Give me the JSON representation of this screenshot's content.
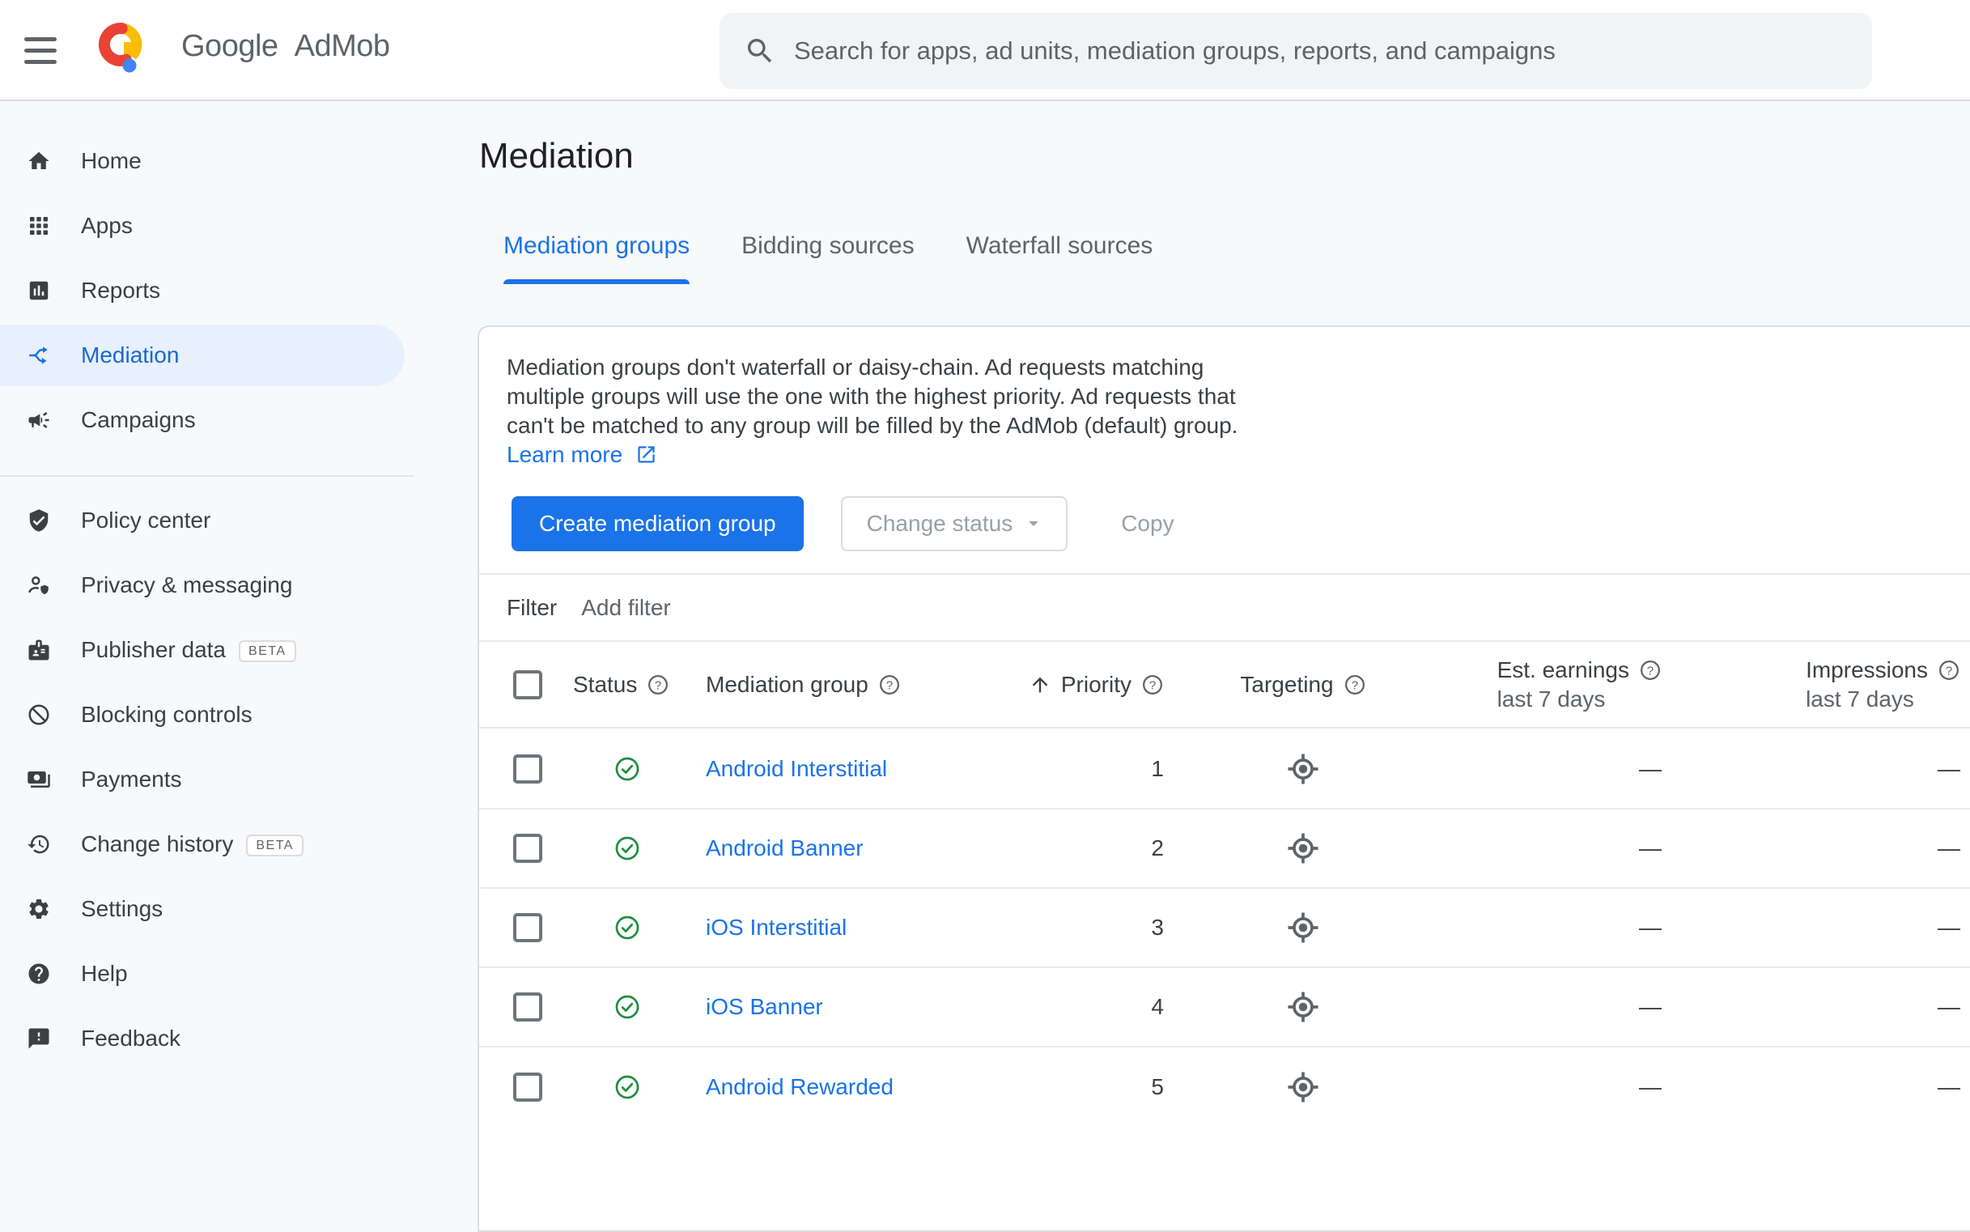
{
  "header": {
    "logo_brand": "Google",
    "logo_product": "AdMob",
    "search": {
      "placeholder": "Search for apps, ad units, mediation groups, reports, and campaigns"
    }
  },
  "sidebar": {
    "beta_label": "BETA",
    "primary": [
      {
        "label": "Home"
      },
      {
        "label": "Apps"
      },
      {
        "label": "Reports"
      },
      {
        "label": "Mediation",
        "active": true
      },
      {
        "label": "Campaigns"
      }
    ],
    "secondary": [
      {
        "label": "Policy center"
      },
      {
        "label": "Privacy & messaging"
      },
      {
        "label": "Publisher data",
        "beta": true
      },
      {
        "label": "Blocking controls"
      },
      {
        "label": "Payments"
      },
      {
        "label": "Change history",
        "beta": true
      },
      {
        "label": "Settings"
      },
      {
        "label": "Help"
      },
      {
        "label": "Feedback"
      }
    ]
  },
  "main": {
    "title": "Mediation",
    "tabs": [
      {
        "label": "Mediation groups",
        "active": true
      },
      {
        "label": "Bidding sources",
        "active": false
      },
      {
        "label": "Waterfall sources",
        "active": false
      }
    ],
    "card": {
      "description": "Mediation groups don't waterfall or daisy-chain. Ad requests matching multiple groups will use the one with the highest priority. Ad requests that can't be matched to any group will be filled by the AdMob (default) group.",
      "learn_more": "Learn more",
      "buttons": {
        "create": "Create mediation group",
        "change_status": "Change status",
        "copy": "Copy"
      },
      "filter": {
        "label": "Filter",
        "add": "Add filter"
      },
      "table": {
        "columns": {
          "status": "Status",
          "group": "Mediation group",
          "priority": "Priority",
          "targeting": "Targeting",
          "earnings_line1": "Est. earnings",
          "earnings_line2": "last 7 days",
          "impressions_line1": "Impressions",
          "impressions_line2": "last 7 days"
        },
        "rows": [
          {
            "name": "Android Interstitial",
            "status": "active",
            "priority": "1",
            "earnings": "—",
            "impressions": "—"
          },
          {
            "name": "Android Banner",
            "status": "active",
            "priority": "2",
            "earnings": "—",
            "impressions": "—"
          },
          {
            "name": "iOS Interstitial",
            "status": "active",
            "priority": "3",
            "earnings": "—",
            "impressions": "—"
          },
          {
            "name": "iOS Banner",
            "status": "active",
            "priority": "4",
            "earnings": "—",
            "impressions": "—"
          },
          {
            "name": "Android Rewarded",
            "status": "active",
            "priority": "5",
            "earnings": "—",
            "impressions": "—"
          }
        ]
      }
    }
  },
  "colors": {
    "accent_blue": "#1a73e8",
    "active_nav_blue": "#1967d2",
    "active_nav_bg": "#e8f0fe",
    "success_green": "#1e8e3e",
    "logo_red": "#ea4335",
    "logo_yellow": "#fbbc04",
    "logo_blue": "#4285f4",
    "text_primary": "#3c4043",
    "text_secondary": "#5f6368",
    "disabled_text": "#9aa0a6",
    "border": "#dadce0",
    "background": "#f8f9fa"
  }
}
